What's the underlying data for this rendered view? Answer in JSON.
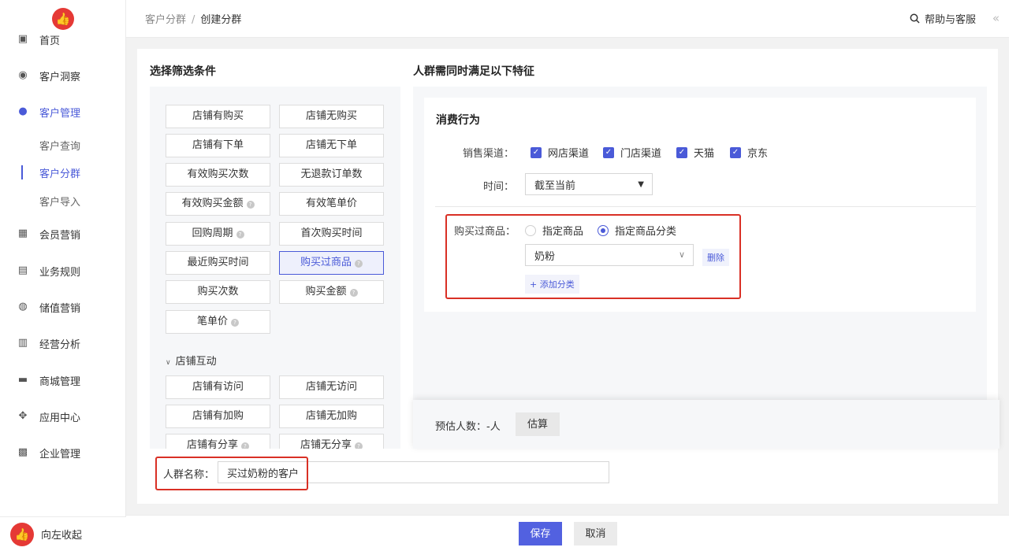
{
  "nav": {
    "items": [
      {
        "label": "首页",
        "icon": "home-icon",
        "glyph": "▣"
      },
      {
        "label": "客户洞察",
        "icon": "eye-icon",
        "glyph": "◉"
      },
      {
        "label": "客户管理",
        "icon": "user-icon",
        "glyph": "●"
      },
      {
        "label": "会员营销",
        "icon": "gift-icon",
        "glyph": "▦"
      },
      {
        "label": "业务规则",
        "icon": "document-icon",
        "glyph": "▤"
      },
      {
        "label": "储值营销",
        "icon": "coin-icon",
        "glyph": "◍"
      },
      {
        "label": "经营分析",
        "icon": "clipboard-icon",
        "glyph": "▥"
      },
      {
        "label": "商城管理",
        "icon": "store-icon",
        "glyph": "▬"
      },
      {
        "label": "应用中心",
        "icon": "apps-icon",
        "glyph": "✥"
      },
      {
        "label": "企业管理",
        "icon": "enterprise-icon",
        "glyph": "▩"
      }
    ],
    "sub_items": [
      "客户查询",
      "客户分群",
      "客户导入"
    ],
    "collapse_label": "向左收起"
  },
  "breadcrumb": {
    "parent": "客户分群",
    "separator": "/",
    "current": "创建分群"
  },
  "help": {
    "label": "帮助与客服"
  },
  "conditions": {
    "title": "选择筛选条件",
    "buttons": [
      {
        "label": "店铺有购买",
        "q": false
      },
      {
        "label": "店铺无购买",
        "q": false
      },
      {
        "label": "店铺有下单",
        "q": false
      },
      {
        "label": "店铺无下单",
        "q": false
      },
      {
        "label": "有效购买次数",
        "q": false
      },
      {
        "label": "无退款订单数",
        "q": false
      },
      {
        "label": "有效购买金额",
        "q": true
      },
      {
        "label": "有效笔单价",
        "q": false
      },
      {
        "label": "回购周期",
        "q": true
      },
      {
        "label": "首次购买时间",
        "q": false
      },
      {
        "label": "最近购买时间",
        "q": false
      },
      {
        "label": "购买过商品",
        "q": true
      },
      {
        "label": "购买次数",
        "q": false
      },
      {
        "label": "购买金额",
        "q": true
      },
      {
        "label": "笔单价",
        "q": true
      }
    ],
    "group": "店铺互动",
    "group_buttons": [
      {
        "label": "店铺有访问",
        "q": false
      },
      {
        "label": "店铺无访问",
        "q": false
      },
      {
        "label": "店铺有加购",
        "q": false
      },
      {
        "label": "店铺无加购",
        "q": false
      },
      {
        "label": "店铺有分享",
        "q": true
      },
      {
        "label": "店铺无分享",
        "q": true
      }
    ]
  },
  "features": {
    "title": "人群需同时满足以下特征",
    "behavior_title": "消费行为",
    "channel_label": "销售渠道：",
    "channels": [
      "网店渠道",
      "门店渠道",
      "天猫",
      "京东"
    ],
    "time_label": "时间：",
    "time_value": "截至当前",
    "goods_label": "购买过商品：",
    "radio_options": [
      "指定商品",
      "指定商品分类"
    ],
    "category_value": "奶粉",
    "delete_label": "删除",
    "add_category_label": "+ 添加分类"
  },
  "estimate": {
    "label": "预估人数：-人",
    "button": "估算"
  },
  "group_name": {
    "label": "人群名称：",
    "value": "买过奶粉的客户"
  },
  "footer": {
    "save": "保存",
    "cancel": "取消"
  },
  "colors": {
    "accent": "#4a5ad8",
    "highlight": "#d93025",
    "logo": "#e53935"
  }
}
